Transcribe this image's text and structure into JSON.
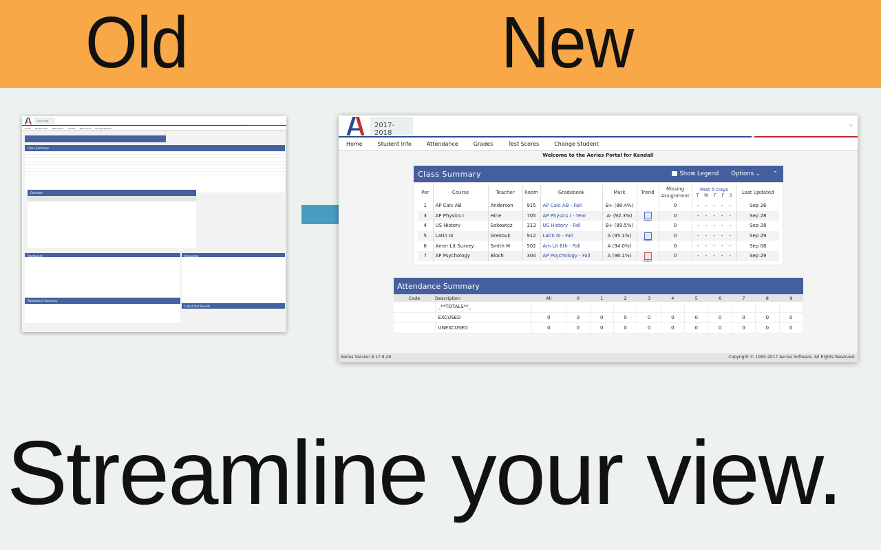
{
  "banner": {
    "old_label": "Old",
    "new_label": "New",
    "color": "#f8a846"
  },
  "tagline": "Streamline your view.",
  "old_screenshot": {
    "year": "2017-2018",
    "nav": [
      "Home",
      "Student Info",
      "Attendance",
      "Grades",
      "Test Scores",
      "Change Student"
    ],
    "panels": [
      "Class Summary",
      "Calendar",
      "Dashboard",
      "Attendance Summary",
      "Resources",
      "Latest Test Results"
    ]
  },
  "new_screenshot": {
    "year": "2017-2018",
    "nav": [
      "Home",
      "Student Info",
      "Attendance",
      "Grades",
      "Test Scores",
      "Change Student"
    ],
    "welcome": "Welcome to the Aeries Portal for Kendall",
    "class_summary": {
      "title": "Class Summary",
      "show_legend": "Show Legend",
      "options": "Options",
      "headers": {
        "per": "Per",
        "course": "Course",
        "teacher": "Teacher",
        "room": "Room",
        "gradebook": "Gradebook",
        "mark": "Mark",
        "trend": "Trend",
        "missing": "Missing Assignment",
        "past5": "Past 5 Days",
        "last_updated": "Last Updated"
      },
      "days": [
        "T",
        "W",
        "T",
        "F",
        "S"
      ],
      "rows": [
        {
          "per": "1",
          "course": "AP Calc AB",
          "teacher": "Anderson",
          "room": "915",
          "gradebook": "AP Calc AB - Fall",
          "mark": "B+ (88.4%)",
          "trend": "",
          "missing": "0",
          "updated": "Sep 26"
        },
        {
          "per": "3",
          "course": "AP Physics I",
          "teacher": "Hine",
          "room": "705",
          "gradebook": "AP Physics I - Year",
          "mark": "A- (92.3%)",
          "trend": "flat",
          "missing": "0",
          "updated": "Sep 28"
        },
        {
          "per": "4",
          "course": "US History",
          "teacher": "Sokowicz",
          "room": "313",
          "gradebook": "US History - Fall",
          "mark": "B+ (89.5%)",
          "trend": "",
          "missing": "0",
          "updated": "Sep 28"
        },
        {
          "per": "5",
          "course": "Latin III",
          "teacher": "Grekouk",
          "room": "912",
          "gradebook": "Latin III - Fall",
          "mark": "A (95.1%)",
          "trend": "flat",
          "missing": "0",
          "updated": "Sep 29"
        },
        {
          "per": "6",
          "course": "Amer Lit Survey",
          "teacher": "Smith M",
          "room": "502",
          "gradebook": "Am Lit 6th - Fall",
          "mark": "A (94.0%)",
          "trend": "",
          "missing": "0",
          "updated": "Sep 08"
        },
        {
          "per": "7",
          "course": "AP Psychology",
          "teacher": "Bloch",
          "room": "304",
          "gradebook": "AP Psychology - Fall",
          "mark": "A (96.1%)",
          "trend": "down",
          "missing": "0",
          "updated": "Sep 29"
        }
      ],
      "trend_label": "Details"
    },
    "attendance_summary": {
      "title": "Attendance Summary",
      "headers": [
        "Code",
        "Description",
        "All",
        "0",
        "1",
        "2",
        "3",
        "4",
        "5",
        "6",
        "7",
        "8",
        "9"
      ],
      "rows": [
        {
          "code": "",
          "description": "_**TOTALS**_",
          "values": [
            "",
            "",
            "",
            "",
            "",
            "",
            "",
            "",
            "",
            "",
            ""
          ]
        },
        {
          "code": "",
          "description": "EXCUSED",
          "values": [
            "0",
            "0",
            "0",
            "0",
            "0",
            "0",
            "0",
            "0",
            "0",
            "0",
            "0"
          ]
        },
        {
          "code": "",
          "description": "UNEXCUSED",
          "values": [
            "0",
            "0",
            "0",
            "0",
            "0",
            "0",
            "0",
            "0",
            "0",
            "0",
            "0"
          ]
        }
      ]
    },
    "footer": {
      "version": "Aeries Version 8.17.9.29",
      "copyright": "Copyright © 1995-2017 Aeries Software. All Rights Reserved."
    }
  }
}
